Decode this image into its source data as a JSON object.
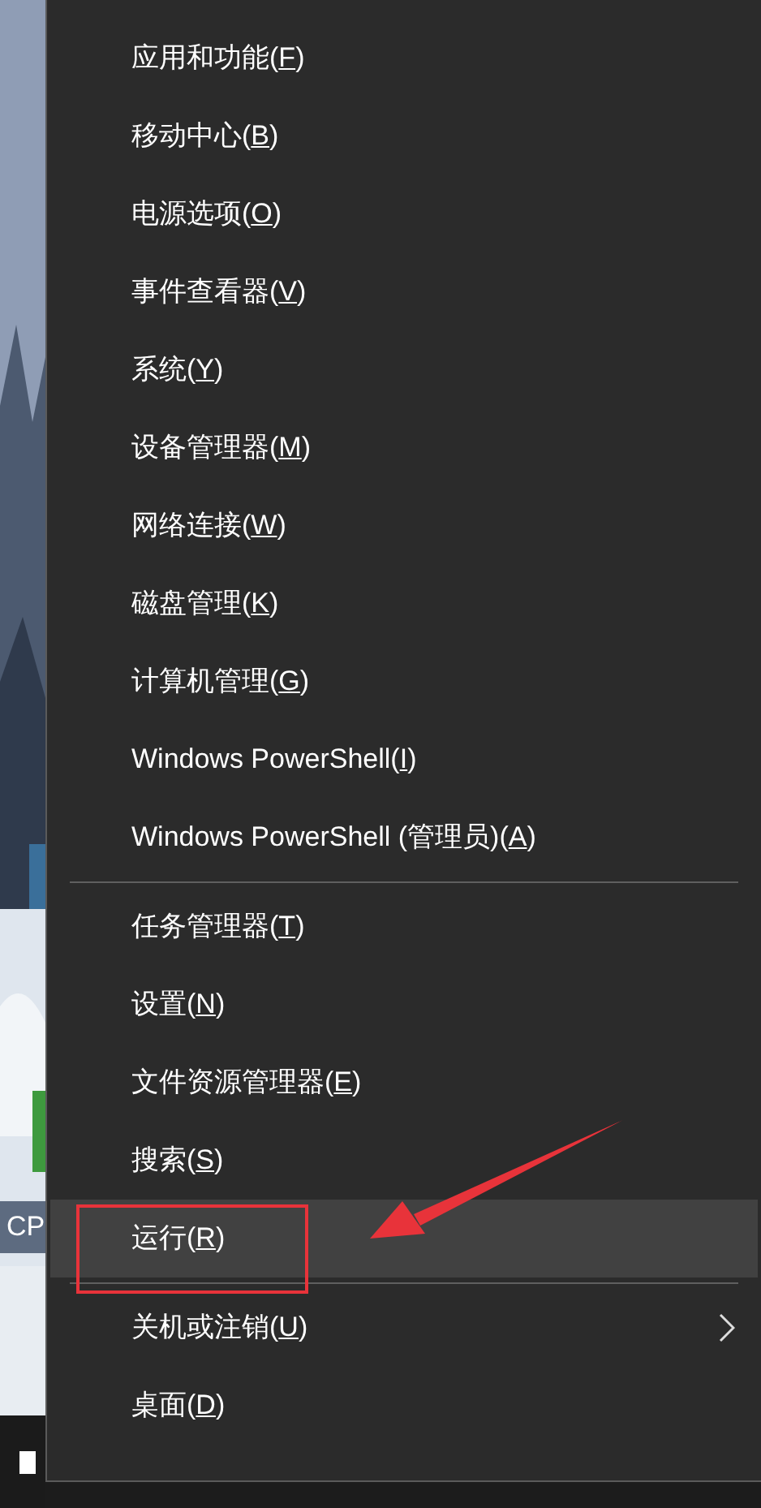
{
  "desktop": {
    "icon_label": "CP"
  },
  "menu": {
    "groups": [
      {
        "items": [
          {
            "before": "应用和功能(",
            "key": "F",
            "after": ")",
            "selected": false,
            "submenu": false
          },
          {
            "before": "移动中心(",
            "key": "B",
            "after": ")",
            "selected": false,
            "submenu": false
          },
          {
            "before": "电源选项(",
            "key": "O",
            "after": ")",
            "selected": false,
            "submenu": false
          },
          {
            "before": "事件查看器(",
            "key": "V",
            "after": ")",
            "selected": false,
            "submenu": false
          },
          {
            "before": "系统(",
            "key": "Y",
            "after": ")",
            "selected": false,
            "submenu": false
          },
          {
            "before": "设备管理器(",
            "key": "M",
            "after": ")",
            "selected": false,
            "submenu": false
          },
          {
            "before": "网络连接(",
            "key": "W",
            "after": ")",
            "selected": false,
            "submenu": false
          },
          {
            "before": "磁盘管理(",
            "key": "K",
            "after": ")",
            "selected": false,
            "submenu": false
          },
          {
            "before": "计算机管理(",
            "key": "G",
            "after": ")",
            "selected": false,
            "submenu": false
          },
          {
            "before": "Windows PowerShell(",
            "key": "I",
            "after": ")",
            "selected": false,
            "submenu": false
          },
          {
            "before": "Windows PowerShell (管理员)(",
            "key": "A",
            "after": ")",
            "selected": false,
            "submenu": false
          }
        ]
      },
      {
        "items": [
          {
            "before": "任务管理器(",
            "key": "T",
            "after": ")",
            "selected": false,
            "submenu": false
          },
          {
            "before": "设置(",
            "key": "N",
            "after": ")",
            "selected": false,
            "submenu": false
          },
          {
            "before": "文件资源管理器(",
            "key": "E",
            "after": ")",
            "selected": false,
            "submenu": false
          },
          {
            "before": "搜索(",
            "key": "S",
            "after": ")",
            "selected": false,
            "submenu": false
          },
          {
            "before": "运行(",
            "key": "R",
            "after": ")",
            "selected": true,
            "submenu": false
          }
        ]
      },
      {
        "items": [
          {
            "before": "关机或注销(",
            "key": "U",
            "after": ")",
            "selected": false,
            "submenu": true
          },
          {
            "before": "桌面(",
            "key": "D",
            "after": ")",
            "selected": false,
            "submenu": false
          }
        ]
      }
    ]
  }
}
